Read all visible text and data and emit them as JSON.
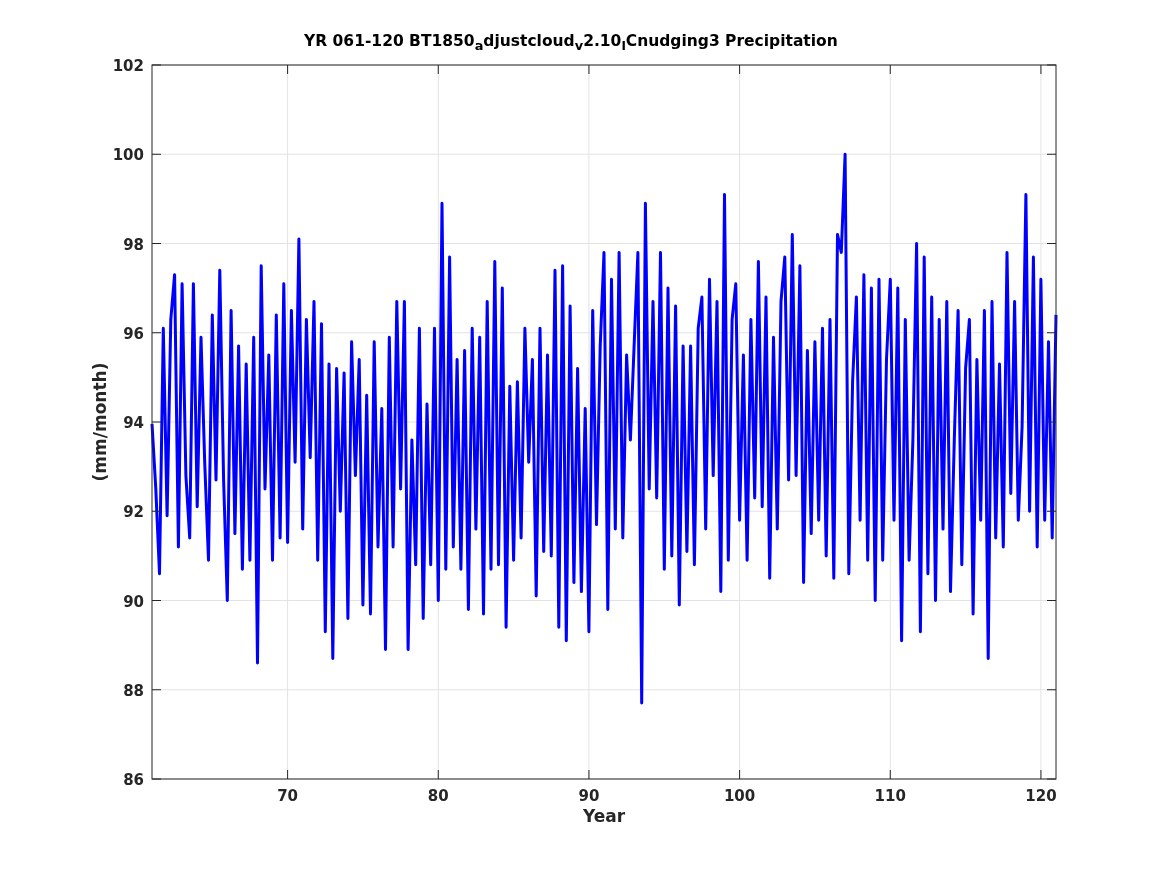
{
  "plot": {
    "chart_data": {
      "type": "line",
      "title": "YR 061-120 BT1850$_{a}$djustcloud$_{v}$2.10$_{l}$Cnudging3 Precipitation",
      "xlabel": "Year",
      "ylabel": "(mm/month)",
      "grid": true,
      "xlim": [
        61,
        121
      ],
      "ylim": [
        86,
        102
      ],
      "xticks": [
        70,
        80,
        90,
        100,
        110,
        120
      ],
      "yticks": [
        86,
        88,
        90,
        92,
        94,
        96,
        98,
        100,
        102
      ],
      "x": [
        61,
        61.25,
        61.5,
        61.75,
        62,
        62.25,
        62.5,
        62.75,
        63,
        63.25,
        63.5,
        63.75,
        64,
        64.25,
        64.5,
        64.75,
        65,
        65.25,
        65.5,
        65.75,
        66,
        66.25,
        66.5,
        66.75,
        67,
        67.25,
        67.5,
        67.75,
        68,
        68.25,
        68.5,
        68.75,
        69,
        69.25,
        69.5,
        69.75,
        70,
        70.25,
        70.5,
        70.75,
        71,
        71.25,
        71.5,
        71.75,
        72,
        72.25,
        72.5,
        72.75,
        73,
        73.25,
        73.5,
        73.75,
        74,
        74.25,
        74.5,
        74.75,
        75,
        75.25,
        75.5,
        75.75,
        76,
        76.25,
        76.5,
        76.75,
        77,
        77.25,
        77.5,
        77.75,
        78,
        78.25,
        78.5,
        78.75,
        79,
        79.25,
        79.5,
        79.75,
        80,
        80.25,
        80.5,
        80.75,
        81,
        81.25,
        81.5,
        81.75,
        82,
        82.25,
        82.5,
        82.75,
        83,
        83.25,
        83.5,
        83.75,
        84,
        84.25,
        84.5,
        84.75,
        85,
        85.25,
        85.5,
        85.75,
        86,
        86.25,
        86.5,
        86.75,
        87,
        87.25,
        87.5,
        87.75,
        88,
        88.25,
        88.5,
        88.75,
        89,
        89.25,
        89.5,
        89.75,
        90,
        90.25,
        90.5,
        90.75,
        91,
        91.25,
        91.5,
        91.75,
        92,
        92.25,
        92.5,
        92.75,
        93,
        93.25,
        93.5,
        93.75,
        94,
        94.25,
        94.5,
        94.75,
        95,
        95.25,
        95.5,
        95.75,
        96,
        96.25,
        96.5,
        96.75,
        97,
        97.25,
        97.5,
        97.75,
        98,
        98.25,
        98.5,
        98.75,
        99,
        99.25,
        99.5,
        99.75,
        100,
        100.25,
        100.5,
        100.75,
        101,
        101.25,
        101.5,
        101.75,
        102,
        102.25,
        102.5,
        102.75,
        103,
        103.25,
        103.5,
        103.75,
        104,
        104.25,
        104.5,
        104.75,
        105,
        105.25,
        105.5,
        105.75,
        106,
        106.25,
        106.5,
        106.75,
        107,
        107.25,
        107.5,
        107.75,
        108,
        108.25,
        108.5,
        108.75,
        109,
        109.25,
        109.5,
        109.75,
        110,
        110.25,
        110.5,
        110.75,
        111,
        111.25,
        111.5,
        111.75,
        112,
        112.25,
        112.5,
        112.75,
        113,
        113.25,
        113.5,
        113.75,
        114,
        114.25,
        114.5,
        114.75,
        115,
        115.25,
        115.5,
        115.75,
        116,
        116.25,
        116.5,
        116.75,
        117,
        117.25,
        117.5,
        117.75,
        118,
        118.25,
        118.5,
        118.75,
        119,
        119.25,
        119.5,
        119.75,
        120,
        120.25,
        120.5,
        120.75,
        121
      ],
      "series": [
        {
          "color": "#0000ff",
          "values": [
            93.96,
            92.5,
            90.6,
            96.1,
            91.9,
            96.3,
            97.3,
            91.2,
            97.1,
            92.8,
            91.4,
            97.1,
            92.1,
            95.9,
            93.1,
            90.9,
            96.4,
            92.7,
            97.4,
            92.7,
            90.0,
            96.5,
            91.5,
            95.7,
            90.7,
            95.3,
            90.9,
            95.9,
            88.6,
            97.5,
            92.5,
            95.5,
            90.9,
            96.4,
            91.4,
            97.1,
            91.3,
            96.5,
            93.1,
            98.1,
            91.6,
            96.3,
            93.2,
            96.7,
            90.9,
            96.2,
            89.3,
            95.3,
            88.7,
            95.2,
            92.0,
            95.1,
            89.6,
            95.8,
            92.8,
            95.4,
            89.9,
            94.6,
            89.7,
            95.8,
            91.2,
            94.3,
            88.9,
            95.9,
            91.2,
            96.7,
            92.5,
            96.7,
            88.9,
            93.6,
            90.8,
            96.1,
            89.6,
            94.4,
            90.8,
            96.1,
            90.0,
            98.9,
            90.7,
            97.7,
            91.2,
            95.4,
            90.7,
            95.6,
            89.8,
            96.1,
            91.6,
            95.9,
            89.7,
            96.7,
            90.7,
            97.6,
            90.8,
            97.0,
            89.4,
            94.8,
            90.9,
            94.9,
            91.4,
            96.1,
            93.1,
            95.4,
            90.1,
            96.1,
            91.1,
            95.5,
            91.0,
            97.4,
            89.4,
            97.5,
            89.1,
            96.6,
            90.4,
            95.2,
            90.2,
            94.3,
            89.3,
            96.5,
            91.7,
            95.7,
            97.8,
            89.8,
            97.2,
            91.6,
            97.8,
            91.4,
            95.5,
            93.6,
            95.7,
            97.8,
            87.7,
            98.9,
            92.5,
            96.7,
            92.3,
            97.8,
            90.7,
            97.0,
            91.0,
            96.6,
            89.9,
            95.7,
            91.1,
            95.7,
            90.8,
            96.1,
            96.8,
            91.6,
            97.2,
            92.8,
            96.7,
            90.2,
            99.1,
            90.9,
            96.3,
            97.1,
            91.8,
            95.5,
            90.9,
            96.3,
            92.3,
            97.6,
            92.1,
            96.8,
            90.5,
            95.9,
            91.6,
            96.7,
            97.7,
            92.7,
            98.2,
            92.8,
            97.5,
            90.4,
            95.6,
            91.5,
            95.8,
            91.8,
            96.1,
            91.0,
            96.3,
            90.5,
            98.2,
            97.8,
            100.0,
            90.6,
            94.9,
            96.8,
            91.8,
            97.3,
            90.9,
            97.0,
            90.0,
            97.2,
            90.9,
            95.4,
            97.2,
            91.8,
            97.0,
            89.1,
            96.3,
            90.9,
            93.6,
            98.0,
            89.3,
            97.7,
            90.6,
            96.8,
            90.0,
            96.3,
            91.6,
            96.7,
            90.2,
            93.6,
            96.5,
            90.8,
            95.2,
            96.3,
            89.7,
            95.4,
            91.8,
            96.5,
            88.7,
            96.7,
            91.4,
            95.3,
            91.2,
            97.8,
            92.4,
            96.7,
            91.8,
            93.9,
            99.1,
            92.0,
            97.7,
            91.2,
            97.2,
            91.8,
            95.8,
            91.4,
            96.4
          ]
        }
      ]
    }
  }
}
